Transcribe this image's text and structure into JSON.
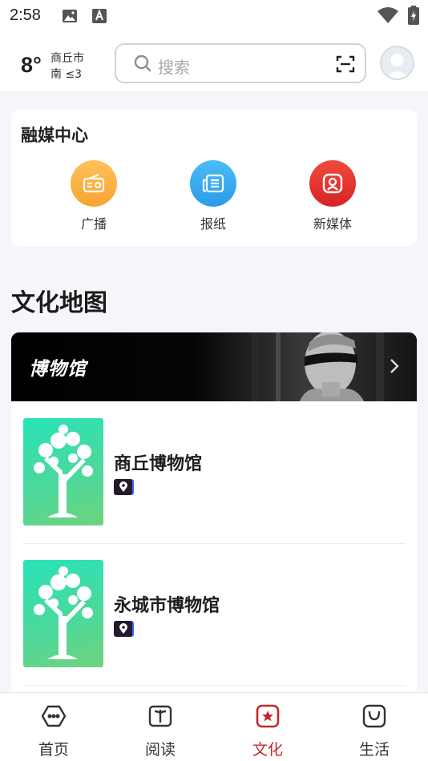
{
  "status_bar": {
    "time": "2:58"
  },
  "header": {
    "temperature": "8°",
    "city": "商丘市",
    "wind": "南 ≤3",
    "search_placeholder": "搜索"
  },
  "media_center": {
    "title": "融媒中心",
    "items": [
      {
        "label": "广播",
        "icon": "radio-icon",
        "color": "#fbb03b"
      },
      {
        "label": "报纸",
        "icon": "newspaper-icon",
        "color": "#36a7f0"
      },
      {
        "label": "新媒体",
        "icon": "new-media-icon",
        "color": "#e23232"
      }
    ]
  },
  "culture_map": {
    "title": "文化地图",
    "banner_title": "博物馆",
    "museums": [
      {
        "name": "商丘博物馆"
      },
      {
        "name": "永城市博物馆"
      }
    ]
  },
  "bottom_nav": {
    "items": [
      {
        "label": "首页",
        "icon": "home-icon",
        "active": false
      },
      {
        "label": "阅读",
        "icon": "book-icon",
        "active": false
      },
      {
        "label": "文化",
        "icon": "culture-star-icon",
        "active": true
      },
      {
        "label": "生活",
        "icon": "shopping-bag-icon",
        "active": false
      }
    ],
    "active_color": "#c0292f"
  }
}
